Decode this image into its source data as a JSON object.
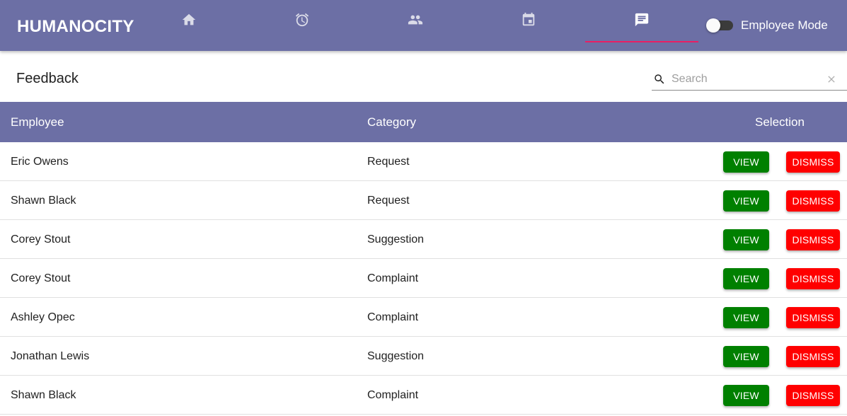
{
  "app": {
    "brand": "HUMANOCITY",
    "mode_label": "Employee Mode",
    "mode_on": false
  },
  "nav": {
    "tabs": [
      {
        "icon": "home-icon",
        "active": false
      },
      {
        "icon": "alarm-clock-icon",
        "active": false
      },
      {
        "icon": "people-icon",
        "active": false
      },
      {
        "icon": "calendar-icon",
        "active": false
      },
      {
        "icon": "message-icon",
        "active": true
      }
    ]
  },
  "page": {
    "title": "Feedback",
    "search": {
      "placeholder": "Search",
      "value": ""
    }
  },
  "table": {
    "headers": {
      "employee": "Employee",
      "category": "Category",
      "selection": "Selection"
    },
    "view_label": "VIEW",
    "dismiss_label": "DISMISS",
    "rows": [
      {
        "employee": "Eric Owens",
        "category": "Request"
      },
      {
        "employee": "Shawn Black",
        "category": "Request"
      },
      {
        "employee": "Corey Stout",
        "category": "Suggestion"
      },
      {
        "employee": "Corey Stout",
        "category": "Complaint"
      },
      {
        "employee": "Ashley Opec",
        "category": "Complaint"
      },
      {
        "employee": "Jonathan Lewis",
        "category": "Suggestion"
      },
      {
        "employee": "Shawn Black",
        "category": "Complaint"
      }
    ]
  },
  "colors": {
    "bar": "#6c6fa5",
    "tab_indicator": "#e91e63",
    "view_button": "#008000",
    "dismiss_button": "#ff0000"
  }
}
